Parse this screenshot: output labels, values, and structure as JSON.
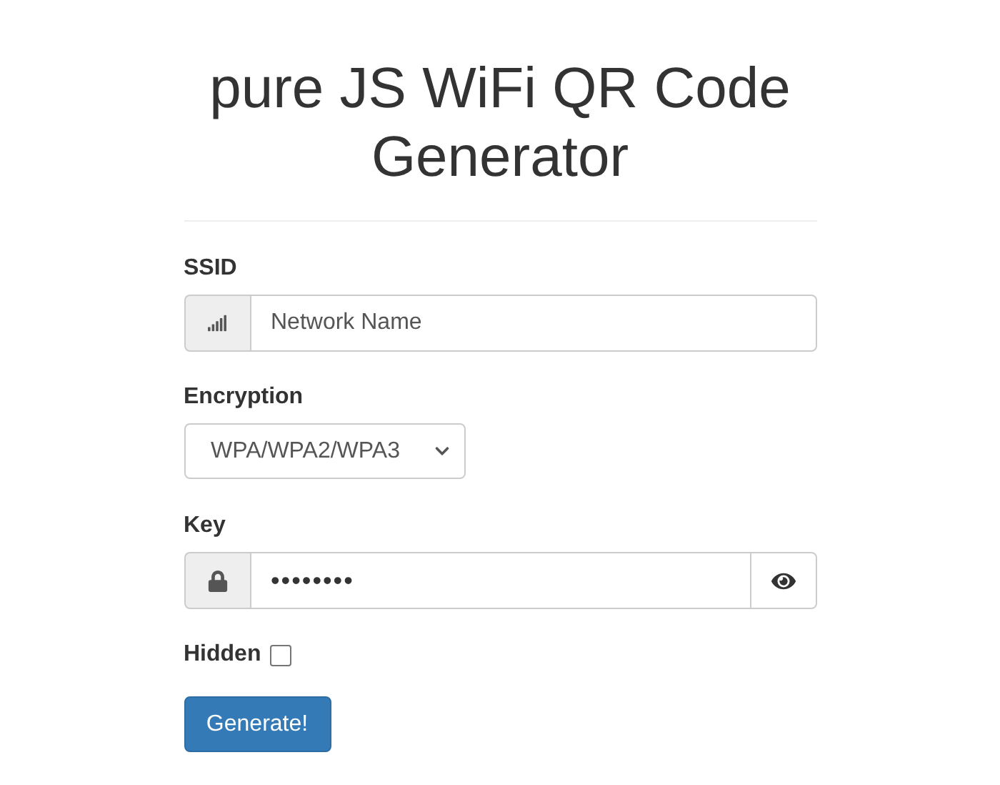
{
  "title": "pure JS WiFi QR Code Generator",
  "ssid": {
    "label": "SSID",
    "placeholder": "Network Name"
  },
  "encryption": {
    "label": "Encryption",
    "value": "WPA/WPA2/WPA3"
  },
  "key": {
    "label": "Key",
    "value": "••••••••"
  },
  "hidden": {
    "label": "Hidden",
    "checked": false
  },
  "button": "Generate!"
}
